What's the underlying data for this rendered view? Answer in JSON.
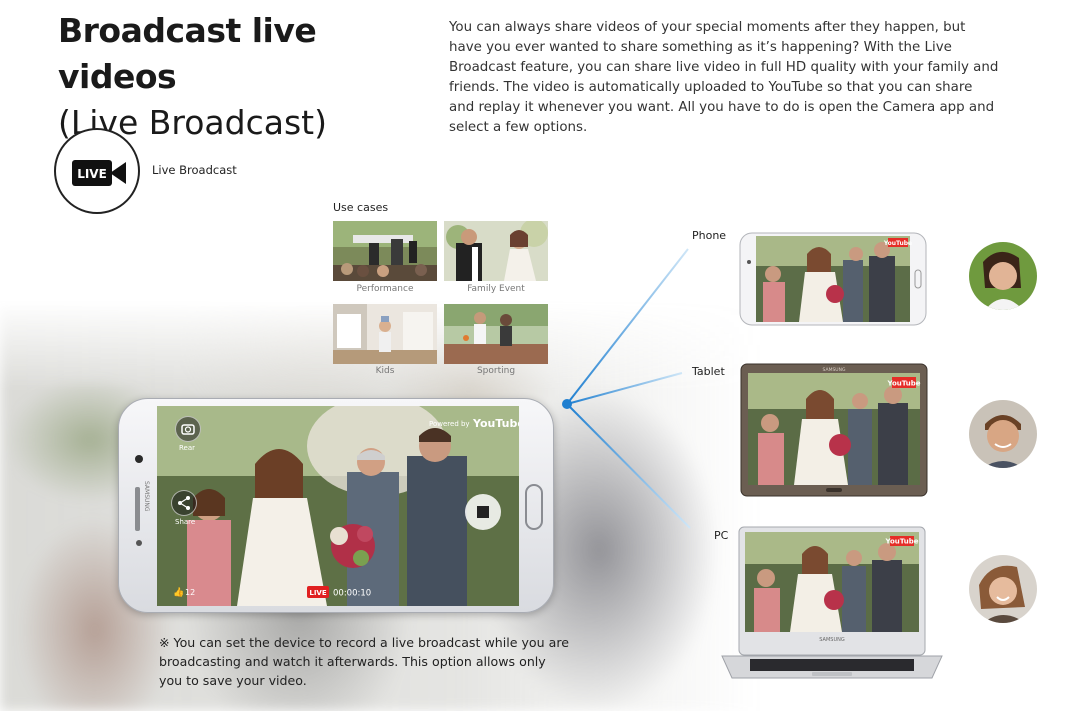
{
  "header": {
    "title_line1": "Broadcast live videos",
    "title_line2": "(Live Broadcast)",
    "intro": "You can always share videos of your special moments after they happen, but have you ever wanted to share something as it’s happening? With the Live Broadcast feature, you can share live video in full HD quality with your family and friends. The video is automatically uploaded to YouTube so that you can share and replay it whenever you want. All you have to do is open the Camera app and select a few options."
  },
  "feature": {
    "icon_text": "LIVE",
    "icon": "live-video-camera-icon",
    "caption": "Live Broadcast"
  },
  "use_cases": {
    "title": "Use cases",
    "items": [
      {
        "label": "Performance"
      },
      {
        "label": "Family Event"
      },
      {
        "label": "Kids"
      },
      {
        "label": "Sporting"
      }
    ]
  },
  "devices": {
    "phone": "Phone",
    "tablet": "Tablet",
    "pc": "PC",
    "youtube_badge": "YouTube",
    "laptop_brand": "SAMSUNG",
    "tablet_brand": "SAMSUNG"
  },
  "main_phone": {
    "brand": "SAMSUNG",
    "rear_label": "Rear",
    "share_label": "Share",
    "powered_by": "Powered by",
    "youtube": "YouTube",
    "likes": "12",
    "live_badge": "LIVE",
    "timer": "00:00:10"
  },
  "note": "※  You can set the device to record a live broadcast while you are broadcasting and watch it afterwards. This option allows only you to save your video.",
  "colors": {
    "accent_line": "#2a8bd8",
    "live_red": "#e02020",
    "youtube_red": "#e52d27"
  }
}
